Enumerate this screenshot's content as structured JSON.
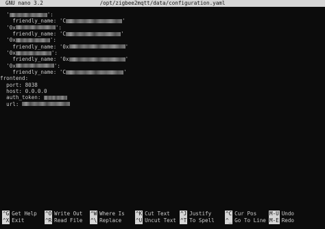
{
  "title_bar": {
    "app": "GNU nano 3.2",
    "file": "/opt/zigbee2mqtt/data/configuration.yaml"
  },
  "editor_lines": [
    {
      "text": "  '",
      "redacted": true,
      "suffix": "':"
    },
    {
      "text": "    friendly_name: 'C",
      "redacted": true,
      "suffix": "'"
    },
    {
      "text": "  '0x",
      "redacted": true,
      "suffix": "':"
    },
    {
      "text": "    friendly_name: 'C",
      "redacted": true,
      "suffix": "'"
    },
    {
      "text": "  '0x",
      "redacted": true,
      "suffix": "':"
    },
    {
      "text": "    friendly_name: '0x",
      "redacted": true,
      "suffix": "'"
    },
    {
      "text": "  '0x",
      "redacted": true,
      "suffix": "':"
    },
    {
      "text": "    friendly_name: '0x",
      "redacted": true,
      "suffix": "'"
    },
    {
      "text": "  '0x",
      "redacted": true,
      "suffix": "':"
    },
    {
      "text": "    friendly_name: 'C",
      "redacted": true,
      "suffix": "'"
    },
    {
      "text": "frontend:",
      "redacted": false,
      "suffix": ""
    },
    {
      "text": "  port: 8038",
      "redacted": false,
      "suffix": ""
    },
    {
      "text": "  host: 0.0.0.0",
      "redacted": false,
      "suffix": ""
    },
    {
      "text": "  auth_token: ",
      "redacted": true,
      "suffix": ""
    },
    {
      "text": "  url: ",
      "redacted": true,
      "suffix": ""
    }
  ],
  "help_bar": [
    {
      "key": "^G",
      "label": "Get Help"
    },
    {
      "key": "^O",
      "label": "Write Out"
    },
    {
      "key": "^W",
      "label": "Where Is"
    },
    {
      "key": "^K",
      "label": "Cut Text"
    },
    {
      "key": "^J",
      "label": "Justify"
    },
    {
      "key": "^C",
      "label": "Cur Pos"
    },
    {
      "key": "M-U",
      "label": "Undo"
    },
    {
      "key": "^X",
      "label": "Exit"
    },
    {
      "key": "^R",
      "label": "Read File"
    },
    {
      "key": "^\\",
      "label": "Replace"
    },
    {
      "key": "^U",
      "label": "Uncut Text"
    },
    {
      "key": "^T",
      "label": "To Spell"
    },
    {
      "key": "^_",
      "label": "Go To Line"
    },
    {
      "key": "M-E",
      "label": "Redo"
    }
  ]
}
